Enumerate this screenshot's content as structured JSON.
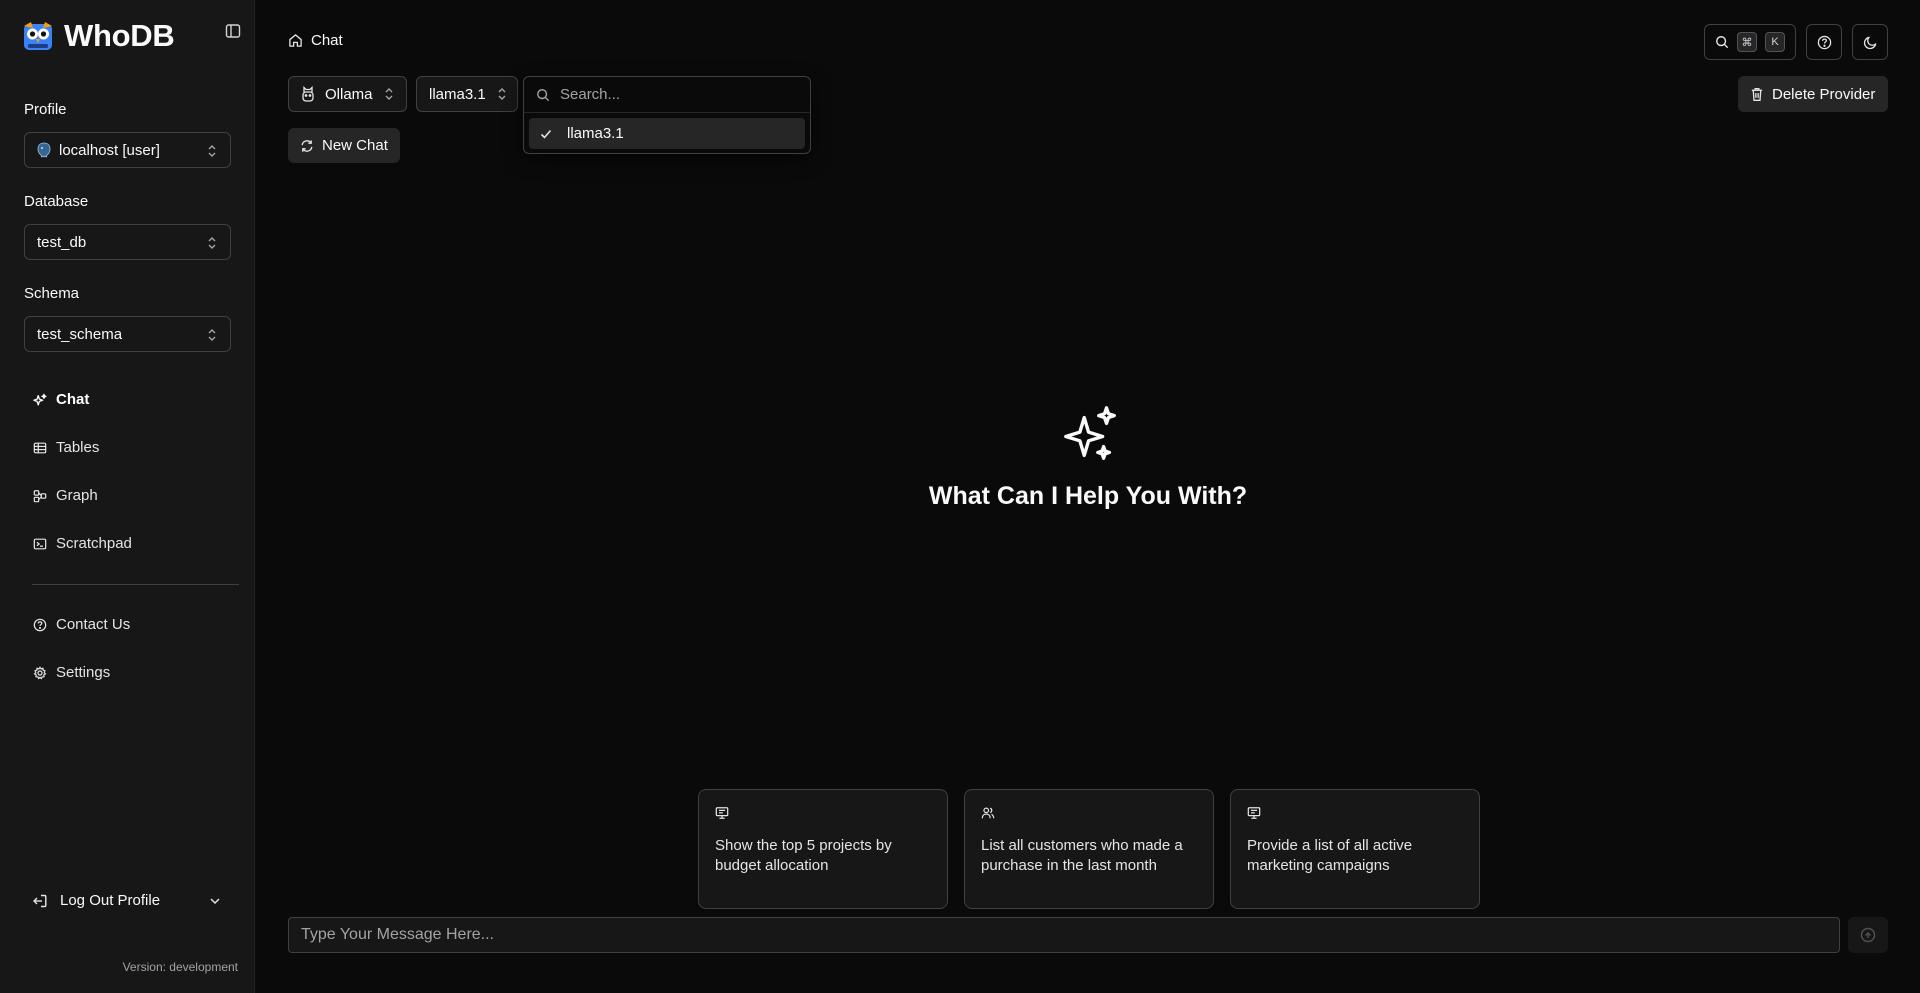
{
  "brand": {
    "name": "WhoDB",
    "logo_icon": "owl-logo-icon"
  },
  "sidebar": {
    "profile": {
      "label": "Profile",
      "value": "localhost [user]",
      "icon": "postgres-elephant-icon"
    },
    "database": {
      "label": "Database",
      "value": "test_db"
    },
    "schema": {
      "label": "Schema",
      "value": "test_schema"
    },
    "nav": [
      {
        "label": "Chat",
        "icon": "sparkles-icon",
        "active": true
      },
      {
        "label": "Tables",
        "icon": "table-icon"
      },
      {
        "label": "Graph",
        "icon": "graph-icon"
      },
      {
        "label": "Scratchpad",
        "icon": "terminal-icon"
      }
    ],
    "secondary_nav": [
      {
        "label": "Contact Us",
        "icon": "help-circle-icon"
      },
      {
        "label": "Settings",
        "icon": "gear-icon"
      }
    ],
    "logout_label": "Log Out Profile",
    "version": "Version: development"
  },
  "header": {
    "breadcrumb": "Chat",
    "kbd": [
      "⌘",
      "K"
    ]
  },
  "chat": {
    "provider": "Ollama",
    "model": "llama3.1",
    "model_dropdown": {
      "placeholder": "Search...",
      "options": [
        {
          "label": "llama3.1",
          "selected": true
        }
      ]
    },
    "delete_provider_label": "Delete Provider",
    "new_chat_label": "New Chat",
    "hero_title": "What Can I Help You With?",
    "suggestions": [
      {
        "text": "Show the top 5 projects by budget allocation",
        "icon": "presentation-icon"
      },
      {
        "text": "List all customers who made a purchase in the last month",
        "icon": "users-icon"
      },
      {
        "text": "Provide a list of all active marketing campaigns",
        "icon": "presentation-icon"
      }
    ],
    "input_placeholder": "Type Your Message Here..."
  },
  "colors": {
    "background": "#0a0a0a",
    "sidebar": "#171717",
    "border": "#3f3f46",
    "text": "#fafafa",
    "muted": "#a3a3a3"
  }
}
